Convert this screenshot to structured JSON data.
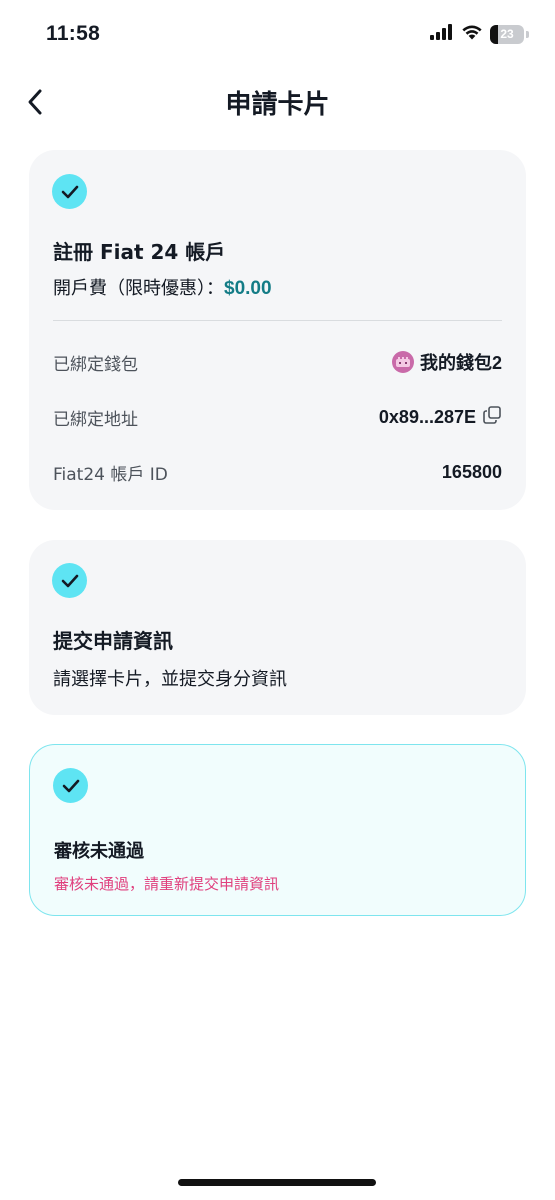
{
  "status_bar": {
    "time": "11:58",
    "battery_level": "23",
    "battery_fraction": 0.23
  },
  "header": {
    "title": "申請卡片",
    "back_icon": "chevron-left-icon"
  },
  "step_register": {
    "status_icon": "checkmark-icon",
    "title": "註冊 Fiat 24 帳戶",
    "fee_label": "開戶費（限時優惠）：",
    "fee_value": "$0.00",
    "details": [
      {
        "label": "已綁定錢包",
        "value": "我的錢包2",
        "icon": "wallet-avatar-icon"
      },
      {
        "label": "已綁定地址",
        "value": "0x89...287E",
        "icon": "copy-icon"
      },
      {
        "label": "Fiat24 帳戶 ID",
        "value": "165800"
      }
    ]
  },
  "step_submit": {
    "status_icon": "checkmark-icon",
    "title": "提交申請資訊",
    "description": "請選擇卡片，並提交身分資訊"
  },
  "step_review": {
    "status_icon": "checkmark-icon",
    "title": "審核未通過",
    "message": "審核未通過，請重新提交申請資訊"
  },
  "colors": {
    "accent": "#5ee4f3",
    "fee_value": "#137c86",
    "error": "#e0407e",
    "card_bg": "#f5f6f8",
    "highlight_border": "#7ee5ee"
  }
}
